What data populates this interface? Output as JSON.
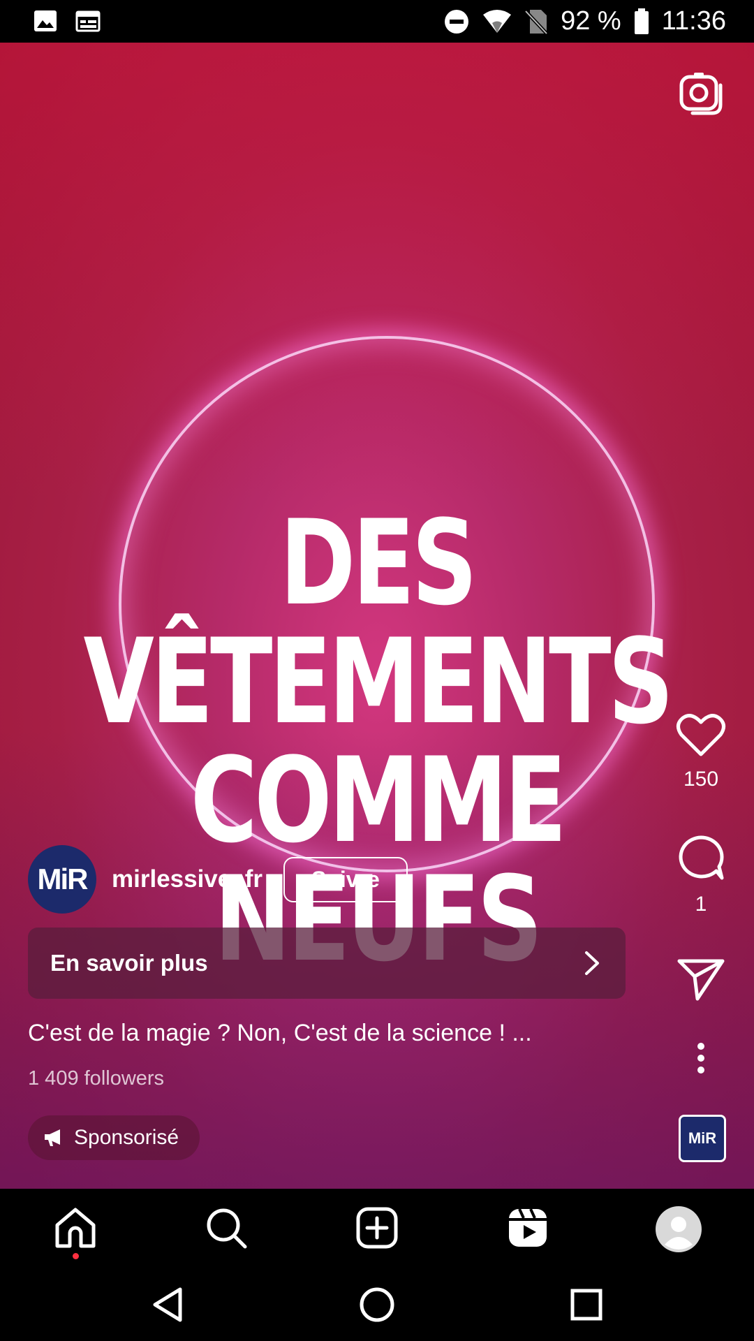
{
  "status_bar": {
    "battery_percent": "92 %",
    "time": "11:36"
  },
  "reel": {
    "headline_line1": "DES VÊTEMENTS",
    "headline_line2": "COMME NEUFS",
    "likes": "150",
    "comments": "1",
    "avatar_text": "MiR",
    "username": "mirlessive_fr",
    "follow_label": "Suivre",
    "cta_label": "En savoir plus",
    "caption": "C'est de la magie ? Non, C'est de la science ! ...",
    "followers": "1 409 followers",
    "sponsored_label": "Sponsorisé",
    "audio_thumb_text": "MiR"
  },
  "colors": {
    "brand_navy": "#1c2a6b",
    "notification_dot": "#ff3040"
  },
  "icons": {
    "status": [
      "image-icon",
      "calendar-icon",
      "dnd-icon",
      "wifi-icon",
      "no-sim-icon",
      "battery-icon"
    ],
    "nav": [
      "home-icon",
      "search-icon",
      "create-icon",
      "reels-icon",
      "profile-icon"
    ],
    "system": [
      "back-icon",
      "home-circle-icon",
      "recents-icon"
    ]
  }
}
